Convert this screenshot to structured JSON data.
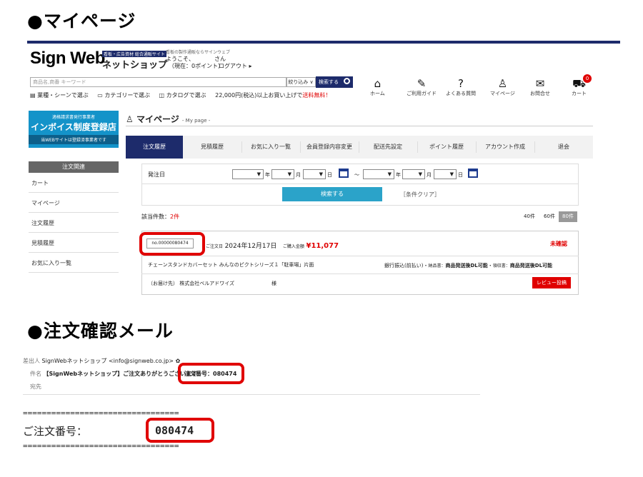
{
  "section1_title": "●マイページ",
  "header": {
    "logo_main": "Sign Web",
    "logo_sub": "ネットショップ",
    "logo_badge": "看板・広告資材 総合通販サイト",
    "tagline": "看板の製作通販ならサインウェブ",
    "welcome": "ようこそ、　　　　さん",
    "points": "（現在：0ポイント）",
    "logout": "ログアウト ▸",
    "search_placeholder": "商品名,商番 キーワード",
    "filter_label": "絞り込み ∨",
    "search_button": "検索する",
    "links": [
      "業種・シーンで選ぶ",
      "カテゴリーで選ぶ",
      "カタログで選ぶ"
    ],
    "shipping_note_prefix": "22,000円(税込)以上お買い上げで",
    "shipping_note_free": "送料無料！",
    "nav": [
      {
        "icon": "home-icon",
        "glyph": "⌂",
        "label": "ホーム"
      },
      {
        "icon": "guide-icon",
        "glyph": "✎",
        "label": "ご利用ガイド"
      },
      {
        "icon": "help-icon",
        "glyph": "?",
        "label": "よくある質問"
      },
      {
        "icon": "user-icon",
        "glyph": "♙",
        "label": "マイページ"
      },
      {
        "icon": "mail-icon",
        "glyph": "✉",
        "label": "お問合せ"
      },
      {
        "icon": "cart-icon",
        "glyph": "⛟",
        "label": "カート"
      }
    ],
    "cart_count": "0"
  },
  "banner": {
    "line1": "適格請求書発行事業者",
    "line2": "インボイス制度登録店",
    "line3": "当WEBサイトは登録済事業者です"
  },
  "sidebar": {
    "heading": "注文関連",
    "items": [
      "カート",
      "マイページ",
      "注文履歴",
      "見積履歴",
      "お気に入り一覧"
    ]
  },
  "page_title": "マイページ",
  "page_title_sub": "- My page -",
  "tabs": [
    "注文履歴",
    "見積履歴",
    "お気に入り一覧",
    "会員登録内容変更",
    "配送先設定",
    "ポイント履歴",
    "アカウント作成",
    "退会"
  ],
  "filter": {
    "label": "発注日",
    "year": "年",
    "month": "月",
    "day": "日",
    "range_sep": "～",
    "search_button": "検索する",
    "clear": "［条件クリア］"
  },
  "results": {
    "count_label": "該当件数：",
    "count_value": "2件",
    "per_page": [
      "40件",
      "60件",
      "80件"
    ]
  },
  "order": {
    "number": "no.00000080474",
    "date_label": "ご注文日",
    "date": "2024年12月17日",
    "amount_label": "ご購入金額",
    "amount": "¥11,077",
    "status": "未確認",
    "item": "チェーンスタンドカバーセット みんなのピクトシリーズ１「駐車場」片面",
    "payment": "銀行振込(前払い)",
    "invoice_label": "納品書：",
    "invoice": "商品発送後DL可能",
    "receipt_label": "領収書：",
    "receipt": "商品発送後DL可能",
    "recipient_label": "（お届け先）",
    "recipient": "株式会社ベルアドワイズ",
    "honorific": "様",
    "review_button": "レビュー投稿"
  },
  "section2_title": "●注文確認メール",
  "email": {
    "from_label": "差出人",
    "from": "SignWebネットショップ <info@signweb.co.jp>",
    "star": "✿",
    "subject_label": "件名",
    "subject": "【SignWebネットショップ】ご注文ありがとうございます",
    "subject_order": "注文番号：080474",
    "to_label": "宛先",
    "divider": "=================================",
    "order_no_label": "ご注文番号：",
    "order_no": "080474"
  },
  "colors": {
    "navy": "#1d2b6b",
    "accent": "#2ba3c9",
    "red": "#e00000",
    "banner": "#1493c9"
  }
}
